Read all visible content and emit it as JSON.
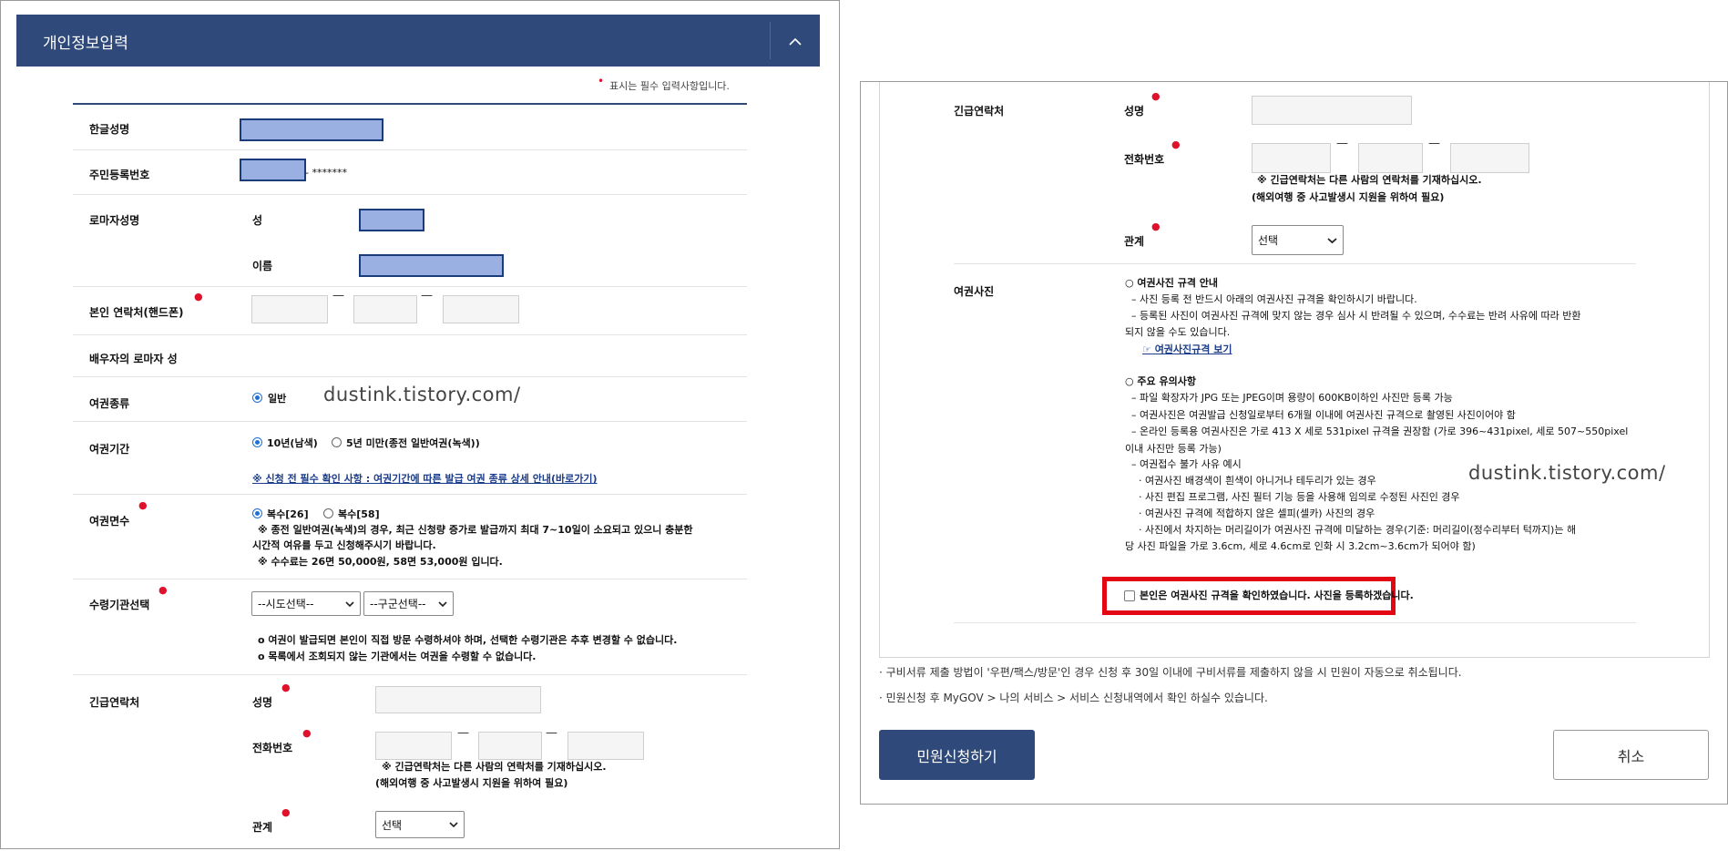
{
  "left": {
    "header_title": "개인정보입력",
    "required_notice": "표시는 필수 입력사항입니다.",
    "fields": {
      "korean_name": "한글성명",
      "resident_no": "주민등록번호",
      "resident_mask": "- *******",
      "roman_name": "로마자성명",
      "surname": "성",
      "given_name": "이름",
      "phone": "본인 연락처(핸드폰)",
      "spouse_roman": "배우자의 로마자 성",
      "passport_type": "여권종류",
      "passport_period": "여권기간",
      "passport_pages": "여권면수",
      "pickup_office": "수령기관선택",
      "emergency": "긴급연락처",
      "em_name": "성명",
      "em_phone": "전화번호",
      "em_relation": "관계"
    },
    "passport_type_option": "일반",
    "period_opt1": "10년(남색)",
    "period_opt2": "5년 미만(종전 일반여권(녹색))",
    "period_link": "※ 신청 전 필수 확인 사항 : 여권기간에 따른 발급 여권 종류 상세 안내(바로가기)",
    "pages_opt1": "복수[26]",
    "pages_opt2": "복수[58]",
    "pages_note1": "※ 종전 일반여권(녹색)의 경우, 최근 신청량 증가로 발급까지 최대 7~10일이 소요되고 있으니 충분한",
    "pages_note2": "시간적 여유를 두고 신청해주시기 바랍니다.",
    "pages_note3": "※ 수수료는 26면 50,000원, 58면 53,000원 입니다.",
    "sido_select": "--시도선택--",
    "gugun_select": "--구군선택--",
    "pickup_note1": "o 여권이 발급되면 본인이 직접 방문 수령하셔야 하며, 선택한 수령기관은 추후 변경할 수 없습니다.",
    "pickup_note2": "o 목록에서 조회되지 않는 기관에서는 여권을 수령할 수 없습니다.",
    "em_note1": "※ 긴급연락처는 다른 사람의 연락처를 기재하십시오.",
    "em_note2": "(해외여행 중 사고발생시 지원을 위하여 필요)",
    "relation_select": "선택",
    "dash": "—",
    "watermark": "dustink.tistory.com/"
  },
  "right": {
    "fields": {
      "emergency": "긴급연락처",
      "em_name": "성명",
      "em_phone": "전화번호",
      "em_relation": "관계",
      "photo": "여권사진"
    },
    "em_note1": "※ 긴급연락처는 다른 사람의 연락처를 기재하십시오.",
    "em_note2": "(해외여행 중 사고발생시 지원을 위하여 필요)",
    "relation_select": "선택",
    "dash": "—",
    "guide_title": "○ 여권사진 규격 안내",
    "guide_l1": "– 사진 등록 전 반드시 아래의 여권사진 규격을 확인하시기 바랍니다.",
    "guide_l2": "– 등록된 사진이 여권사진 규격에 맞지 않는 경우 심사 시 반려될 수 있으며, 수수료는 반려 사유에 따라 반환",
    "guide_l3": "되지 않을 수도 있습니다.",
    "guide_link": "☞ 여권사진규격 보기",
    "caution_title": "○ 주요 유의사항",
    "caution_l1": "– 파일 확장자가 JPG 또는 JPEG이며 용량이 600KB이하인 사진만 등록 가능",
    "caution_l2": "– 여권사진은 여권발급 신청일로부터 6개월 이내에 여권사진 규격으로 촬영된 사진이어야 함",
    "caution_l3": "– 온라인 등록용 여권사진은 가로 413 X 세로 531pixel 규격을 권장함 (가로 396~431pixel, 세로 507~550pixel",
    "caution_l4": "이내 사진만 등록 가능)",
    "caution_l5": "– 여권접수 불가 사유 예시",
    "caution_l6": "· 여권사진 배경색이 흰색이 아니거나 테두리가 있는 경우",
    "caution_l7": "· 사진 편집 프로그램, 사진 필터 기능 등을 사용해 임의로 수정된 사진인 경우",
    "caution_l8": "· 여권사진 규격에 적합하지 않은 셀피(셀카) 사진의 경우",
    "caution_l9": "· 사진에서 차지하는 머리길이가 여권사진 규격에 미달하는 경우(기준: 머리길이(정수리부터 턱까지)는 해",
    "caution_l10": "당 사진 파일을 가로 3.6cm, 세로 4.6cm로 인화 시 3.2cm~3.6cm가 되어야 함)",
    "confirm_text": "본인은 여권사진 규격을 확인하였습니다. 사진을 등록하겠습니다.",
    "bullet1": "· 구비서류 제출 방법이 '우편/팩스/방문'인 경우 신청 후 30일 이내에 구비서류를 제출하지 않을 시 민원이 자동으로 취소됩니다.",
    "bullet2": "· 민원신청 후 MyGOV > 나의 서비스 > 서비스 신청내역에서 확인 하실수 있습니다.",
    "submit_button": "민원신청하기",
    "cancel_button": "취소",
    "watermark": "dustink.tistory.com/"
  },
  "colors": {
    "header_bg": "#2f4a7a",
    "submit_bg": "#2f4a7a",
    "highlight": "#e30613",
    "required": "#e0112b"
  }
}
